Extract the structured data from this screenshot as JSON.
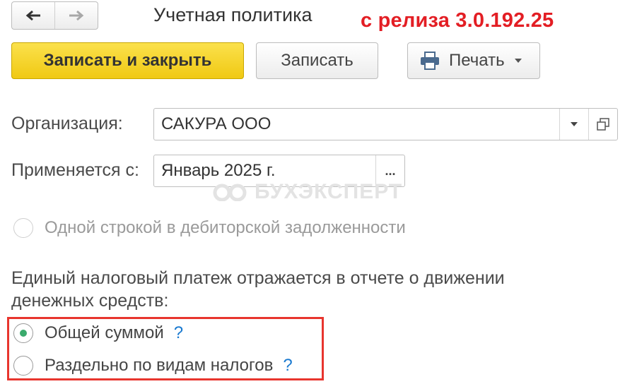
{
  "nav": {
    "back_icon": "arrow-left-icon",
    "forward_icon": "arrow-right-icon"
  },
  "window": {
    "title": "Учетная политика"
  },
  "annotation": {
    "release": "с релиза 3.0.192.25"
  },
  "toolbar": {
    "save_close_label": "Записать и закрыть",
    "save_label": "Записать",
    "print_label": "Печать"
  },
  "form": {
    "organization": {
      "label": "Организация:",
      "value": "САКУРА ООО"
    },
    "applies_from": {
      "label": "Применяется с:",
      "value": "Январь 2025 г.",
      "select_button": "..."
    },
    "debt_option": "Одной строкой в дебиторской задолженности",
    "ens_caption": "Единый налоговый платеж отражается в отчете о движении денежных средств:",
    "options": [
      {
        "label": "Общей суммой",
        "selected": true,
        "help": "?"
      },
      {
        "label": "Раздельно по видам налогов",
        "selected": false,
        "help": "?"
      }
    ]
  },
  "watermark": {
    "text": "БУХЭКСПЕРТ"
  },
  "colors": {
    "primary_button": "#f0c913",
    "annotation": "#e31e24",
    "radio_selected": "#3aaa6c",
    "help": "#1a7ad0",
    "highlight_box": "#e8352e"
  }
}
